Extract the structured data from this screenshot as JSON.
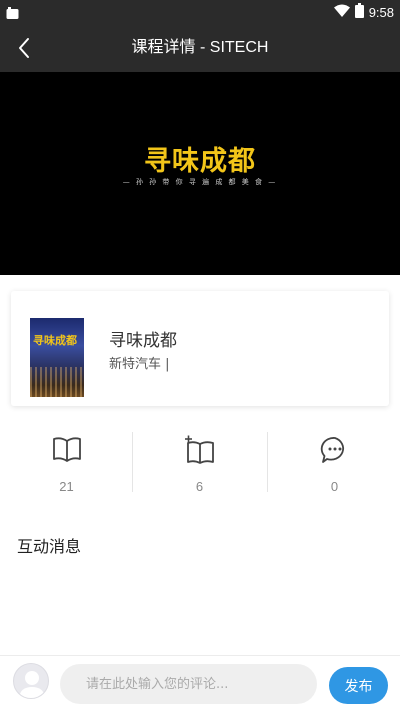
{
  "status_bar": {
    "time": "9:58",
    "icons": [
      "notification-square-icon",
      "wifi-icon",
      "battery-icon"
    ]
  },
  "app_bar": {
    "title": "课程详情 - SITECH",
    "back_icon": "chevron-left-icon"
  },
  "video": {
    "title": "寻味成都",
    "subtitle": "— 孙 孙 带 你 寻 遍 成 都 美 食 —"
  },
  "course": {
    "cover_title": "寻味成都",
    "name": "寻味成都",
    "org": "新特汽车 |"
  },
  "stats": [
    {
      "icon": "open-book-icon",
      "count": "21"
    },
    {
      "icon": "add-book-icon",
      "count": "6"
    },
    {
      "icon": "comment-bubble-icon",
      "count": "0"
    }
  ],
  "section": {
    "title": "互动消息"
  },
  "comment_bar": {
    "placeholder": "请在此处输入您的评论...",
    "publish_label": "发布"
  },
  "colors": {
    "bar_bg": "#2b2b2b",
    "video_title": "#f2c519",
    "accent": "#2f97e4"
  }
}
